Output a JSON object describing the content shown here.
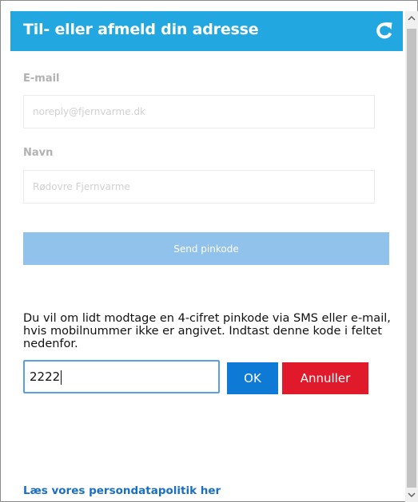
{
  "header": {
    "title": "Til- eller afmeld din adresse",
    "refresh_icon": "refresh-icon",
    "color": "#22a7e0"
  },
  "form": {
    "email_label": "E-mail",
    "email_value": "noreply@fjernvarme.dk",
    "name_label": "Navn",
    "name_value": "Rødovre Fjernvarme",
    "send_button": "Send pinkode"
  },
  "pin": {
    "info_text": "Du vil om lidt modtage en 4-cifret pinkode via SMS eller e-mail, hvis mobilnummer ikke er angivet. Indtast denne kode i feltet nedenfor.",
    "value": "2222",
    "ok_label": "OK",
    "cancel_label": "Annuller",
    "ok_color": "#0e7ad6",
    "cancel_color": "#e01a2b"
  },
  "footer": {
    "policy_link": "Læs vores persondatapolitik her"
  }
}
